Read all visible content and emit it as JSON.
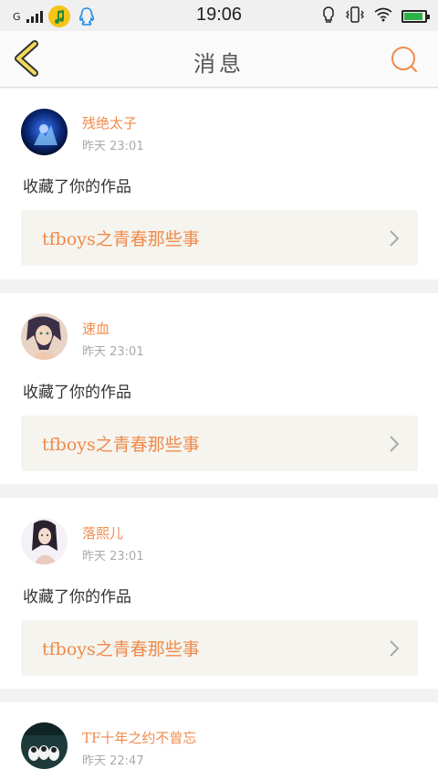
{
  "status_bar": {
    "carrier": "G",
    "time": "19:06",
    "battery_level": 0.9,
    "colors": {
      "battery": "#2db24a",
      "music_app": "#f5c518",
      "qq": "#1e88e5"
    }
  },
  "header": {
    "title": "消息",
    "back_icon": "back-chevron-icon",
    "search_icon": "search-icon",
    "accent_color": "#f08a4b"
  },
  "messages": [
    {
      "username": "残绝太子",
      "time": "昨天 23:01",
      "action": "收藏了你的作品",
      "work_title": "tfboys之青春那些事"
    },
    {
      "username": "速血",
      "time": "昨天 23:01",
      "action": "收藏了你的作品",
      "work_title": "tfboys之青春那些事"
    },
    {
      "username": "落熙儿",
      "time": "昨天 23:01",
      "action": "收藏了你的作品",
      "work_title": "tfboys之青春那些事"
    },
    {
      "username": "TF十年之约不曾忘",
      "time": "昨天 22:47"
    }
  ]
}
